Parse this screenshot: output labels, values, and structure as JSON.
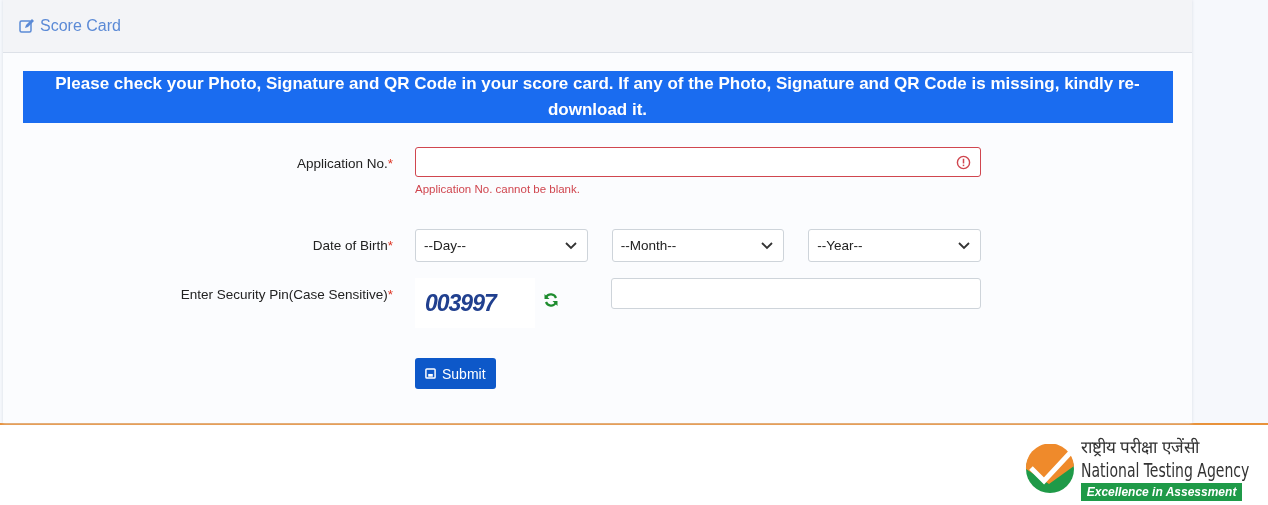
{
  "card": {
    "title": "Score Card"
  },
  "notice": {
    "text": "Please check your Photo, Signature and QR Code in your score card. If any of the Photo, Signature and QR Code is missing, kindly re-download it.",
    "highlighted": true
  },
  "form": {
    "application_no": {
      "label": "Application No.",
      "required": "*",
      "invalid": true,
      "error": "Application No. cannot be blank."
    },
    "date_of_birth": {
      "label": "Date of Birth",
      "required": "*",
      "selects": [
        "--Day--",
        "--Month--",
        "--Year--"
      ]
    },
    "security_pin": {
      "label": "Enter Security Pin(Case Sensitive)",
      "required": "*",
      "captcha": "003997"
    },
    "submit": "Submit"
  },
  "footer": {
    "logo": {
      "hindi": "राष्ट्रीय परीक्षा एजेंसी",
      "name": "National Testing Agency",
      "tagline": "Excellence in Assessment"
    }
  }
}
